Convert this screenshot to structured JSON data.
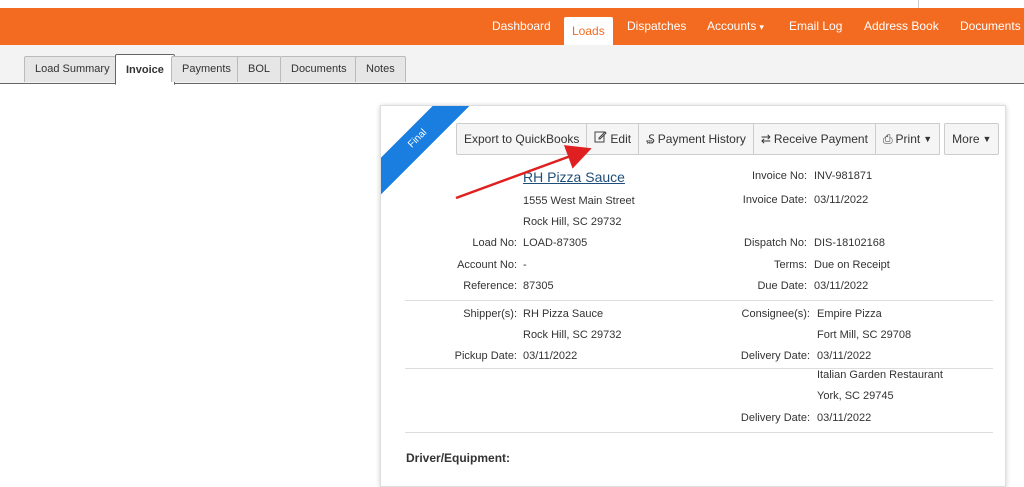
{
  "nav": {
    "items": [
      {
        "label": "Dashboard"
      },
      {
        "label": "Loads"
      },
      {
        "label": "Dispatches"
      },
      {
        "label": "Accounts"
      },
      {
        "label": "Email Log"
      },
      {
        "label": "Address Book"
      },
      {
        "label": "Documents"
      }
    ],
    "active": "Loads"
  },
  "tabs": [
    {
      "label": "Load Summary"
    },
    {
      "label": "Invoice"
    },
    {
      "label": "Payments"
    },
    {
      "label": "BOL"
    },
    {
      "label": "Documents"
    },
    {
      "label": "Notes"
    }
  ],
  "invoice": {
    "status_ribbon": "Final",
    "toolbar": {
      "export": "Export to QuickBooks",
      "edit": "Edit",
      "payment_history": "Payment History",
      "receive_payment": "Receive Payment",
      "print": "Print",
      "more": "More"
    },
    "shipper_name": "RH Pizza Sauce",
    "shipper_address1": "1555 West Main Street",
    "shipper_address2": "Rock Hill, SC 29732",
    "fields_left": {
      "load_no_label": "Load No:",
      "load_no": "LOAD-87305",
      "account_no_label": "Account No:",
      "account_no": "-",
      "reference_label": "Reference:",
      "reference": "87305"
    },
    "fields_right": {
      "invoice_no_label": "Invoice No:",
      "invoice_no": "INV-981871",
      "invoice_date_label": "Invoice Date:",
      "invoice_date": "03/11/2022",
      "dispatch_no_label": "Dispatch No:",
      "dispatch_no": "DIS-18102168",
      "terms_label": "Terms:",
      "terms": "Due on Receipt",
      "due_date_label": "Due Date:",
      "due_date": "03/11/2022"
    },
    "stops": {
      "shippers_label": "Shipper(s):",
      "shipper1_name": "RH Pizza Sauce",
      "shipper1_city": "Rock Hill, SC 29732",
      "pickup_date_label": "Pickup Date:",
      "pickup_date": "03/11/2022",
      "consignees_label": "Consignee(s):",
      "consignee1_name": "Empire Pizza",
      "consignee1_city": "Fort Mill, SC 29708",
      "delivery1_label": "Delivery Date:",
      "delivery1_date": "03/11/2022",
      "consignee2_name": "Italian Garden Restaurant",
      "consignee2_city": "York, SC 29745",
      "delivery2_label": "Delivery Date:",
      "delivery2_date": "03/11/2022"
    },
    "driver_equipment_label": "Driver/Equipment:"
  },
  "colors": {
    "brand": "#f36b21",
    "ribbon": "#1a7de0",
    "annotation_arrow": "#e02020"
  }
}
